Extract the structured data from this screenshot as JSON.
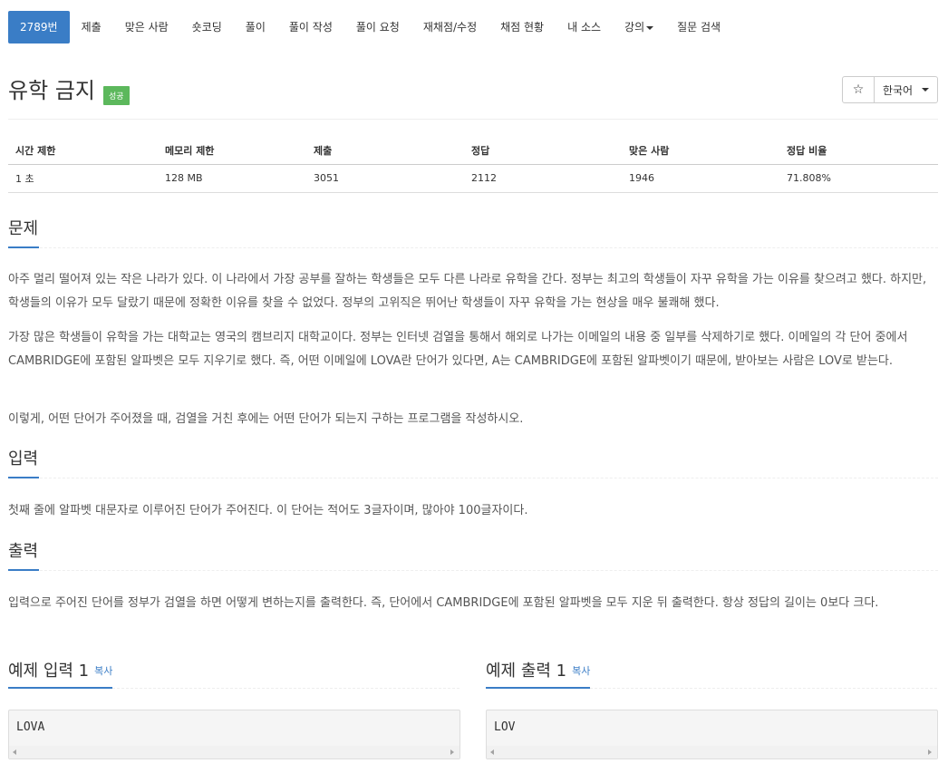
{
  "nav": {
    "items": [
      "2789번",
      "제출",
      "맞은 사람",
      "숏코딩",
      "풀이",
      "풀이 작성",
      "풀이 요청",
      "재채점/수정",
      "채점 현황",
      "내 소스",
      "강의",
      "질문 검색"
    ]
  },
  "header": {
    "title": "유학 금지",
    "badge": "성공",
    "star": "☆",
    "language": "한국어"
  },
  "info": {
    "headers": [
      "시간 제한",
      "메모리 제한",
      "제출",
      "정답",
      "맞은 사람",
      "정답 비율"
    ],
    "values": [
      "1 초",
      "128 MB",
      "3051",
      "2112",
      "1946",
      "71.808%"
    ]
  },
  "problem": {
    "heading": "문제",
    "p1": "아주 멀리 떨어져 있는 작은 나라가 있다. 이 나라에서 가장 공부를 잘하는 학생들은 모두 다른 나라로 유학을 간다. 정부는 최고의 학생들이 자꾸 유학을 가는 이유를 찾으려고 했다. 하지만, 학생들의 이유가 모두 달랐기 때문에 정확한 이유를 찾을 수 없었다. 정부의 고위직은 뛰어난 학생들이 자꾸 유학을 가는 현상을 매우 불쾌해 했다.",
    "p2": "가장 많은 학생들이 유학을 가는 대학교는 영국의 캠브리지 대학교이다. 정부는 인터넷 검열을 통해서 해외로 나가는 이메일의 내용 중 일부를 삭제하기로 했다. 이메일의 각 단어 중에서 CAMBRIDGE에 포함된 알파벳은 모두 지우기로 했다. 즉, 어떤 이메일에 LOVA란 단어가 있다면, A는 CAMBRIDGE에 포함된 알파벳이기 때문에, 받아보는 사람은 LOV로 받는다.",
    "p3": "이렇게, 어떤 단어가 주어졌을 때, 검열을 거친 후에는 어떤 단어가 되는지 구하는 프로그램을 작성하시오."
  },
  "input": {
    "heading": "입력",
    "text": "첫째 줄에 알파벳 대문자로 이루어진 단어가 주어진다. 이 단어는 적어도 3글자이며, 많아야 100글자이다."
  },
  "output": {
    "heading": "출력",
    "text": "입력으로 주어진 단어를 정부가 검열을 하면 어떻게 변하는지를 출력한다. 즉, 단어에서 CAMBRIDGE에 포함된 알파벳을 모두 지운 뒤 출력한다. 항상 정답의 길이는 0보다 크다."
  },
  "samples": {
    "input_heading": "예제 입력 1",
    "output_heading": "예제 출력 1",
    "copy_label": "복사",
    "input_value": "LOVA",
    "output_value": "LOV"
  }
}
